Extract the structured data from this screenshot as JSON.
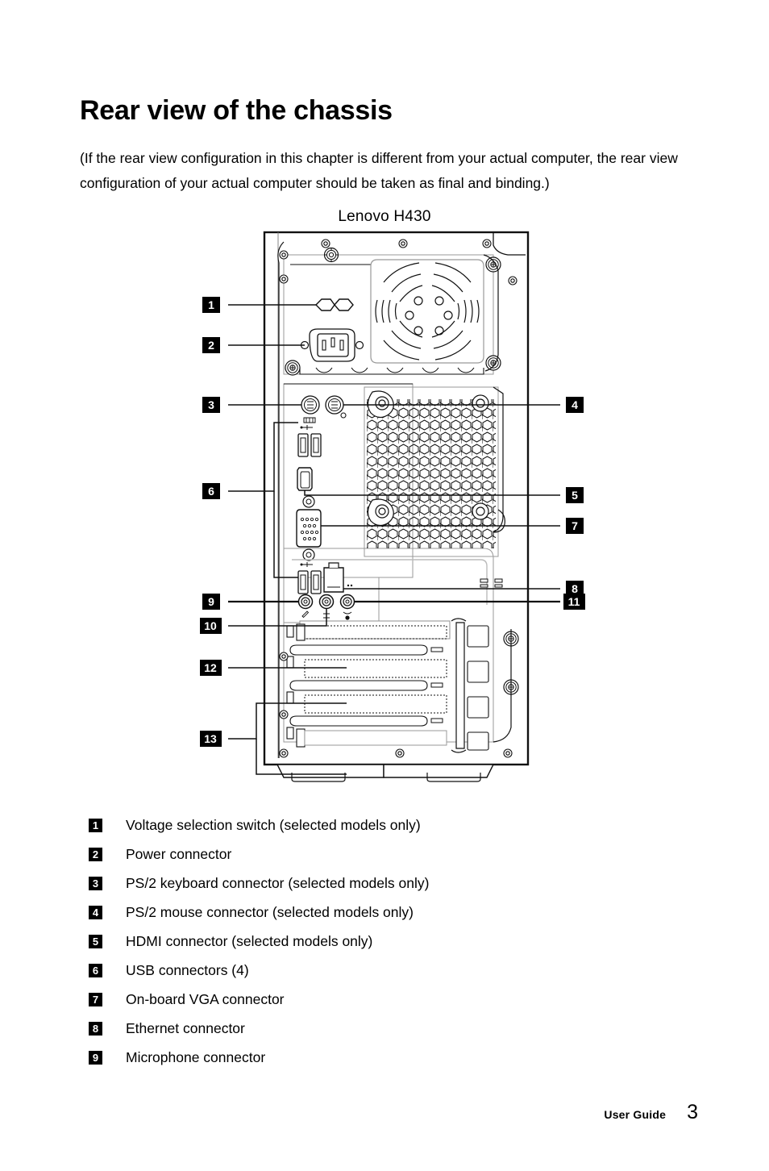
{
  "document": {
    "title": "Rear view of the chassis",
    "intro": "(If the rear view configuration in this chapter is different from your actual computer, the rear view configuration of your actual computer should be taken as final and binding.)"
  },
  "figure": {
    "caption": "Lenovo H430",
    "callouts": [
      {
        "number": "1",
        "side": "left",
        "label": "voltage-selection-switch"
      },
      {
        "number": "2",
        "side": "left",
        "label": "power-connector"
      },
      {
        "number": "3",
        "side": "left",
        "label": "ps2-keyboard-connector"
      },
      {
        "number": "4",
        "side": "right",
        "label": "ps2-mouse-connector"
      },
      {
        "number": "5",
        "side": "right",
        "label": "hdmi-connector"
      },
      {
        "number": "6",
        "side": "left",
        "label": "usb-connectors"
      },
      {
        "number": "7",
        "side": "right",
        "label": "onboard-vga-connector"
      },
      {
        "number": "8",
        "side": "right",
        "label": "ethernet-connector"
      },
      {
        "number": "9",
        "side": "left",
        "label": "microphone-connector"
      },
      {
        "number": "10",
        "side": "left",
        "label": "audio-line-in-connector"
      },
      {
        "number": "11",
        "side": "right",
        "label": "audio-line-out-connector"
      },
      {
        "number": "12",
        "side": "left",
        "label": "pci-express-slot"
      },
      {
        "number": "13",
        "side": "left",
        "label": "expansion-card-slots"
      }
    ]
  },
  "legend": {
    "items": [
      {
        "number": "1",
        "text": "Voltage selection switch (selected models only)"
      },
      {
        "number": "2",
        "text": "Power connector"
      },
      {
        "number": "3",
        "text": "PS/2 keyboard connector (selected models only)"
      },
      {
        "number": "4",
        "text": "PS/2 mouse connector (selected models only)"
      },
      {
        "number": "5",
        "text": "HDMI connector (selected models only)"
      },
      {
        "number": "6",
        "text": "USB connectors (4)"
      },
      {
        "number": "7",
        "text": "On-board VGA connector"
      },
      {
        "number": "8",
        "text": "Ethernet connector"
      },
      {
        "number": "9",
        "text": "Microphone connector"
      }
    ]
  },
  "footer": {
    "label": "User Guide",
    "page": "3"
  },
  "colors": {
    "ink": "#000000",
    "line": "#1a1a1a",
    "shade": "#c9c9c9",
    "background": "#ffffff"
  }
}
